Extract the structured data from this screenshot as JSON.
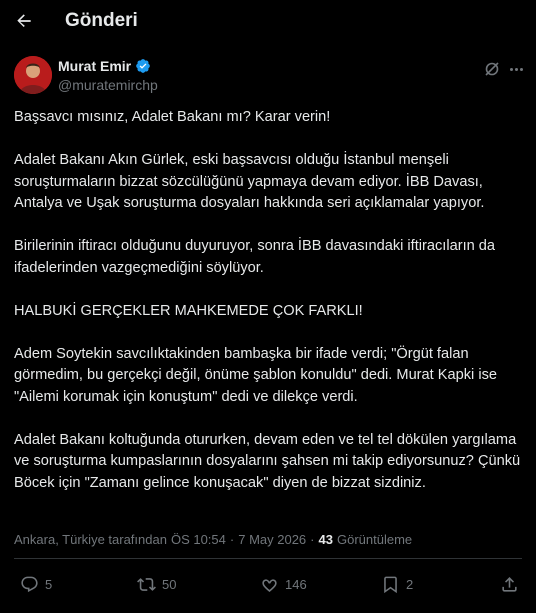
{
  "header": {
    "title": "Gönderi"
  },
  "author": {
    "name": "Murat Emir",
    "handle": "@muratemirchp"
  },
  "post": {
    "paragraphs": [
      "Başsavcı mısınız, Adalet Bakanı mı? Karar verin!",
      "Adalet Bakanı Akın Gürlek, eski başsavcısı olduğu İstanbul menşeli soruşturmaların bizzat sözcülüğünü yapmaya devam ediyor. İBB Davası, Antalya ve Uşak soruşturma dosyaları hakkında seri açıklamalar yapıyor.",
      "Birilerinin iftiracı olduğunu duyuruyor, sonra İBB davasındaki iftiracıların da ifadelerinden vazgeçmediğini söylüyor.",
      "HALBUKİ GERÇEKLER MAHKEMEDE ÇOK FARKLI!",
      "Adem Soytekin savcılıktakinden bambaşka bir ifade verdi; \"Örgüt falan görmedim, bu gerçekçi değil, önüme şablon konuldu\" dedi. Murat Kapki ise \"Ailemi korumak için konuştum\" dedi ve dilekçe verdi.",
      "Adalet Bakanı koltuğunda otururken, devam eden ve tel tel dökülen yargılama ve soruşturma kumpaslarının dosyalarını şahsen mi takip ediyorsunuz? Çünkü Böcek için \"Zamanı gelince konuşacak\" diyen de bizzat sizdiniz."
    ]
  },
  "meta": {
    "location": "Ankara, Türkiye tarafından",
    "time": "ÖS 10:54",
    "separator": "·",
    "date": "7 May 2026",
    "views_count": "43",
    "views_label": "Görüntüleme"
  },
  "actions": {
    "replies": "5",
    "reposts": "50",
    "likes": "146",
    "bookmarks": "2"
  },
  "colors": {
    "background": "#000000",
    "text": "#e7e9ea",
    "secondary": "#71767b",
    "verified": "#1d9bf0",
    "divider": "#2f3336"
  }
}
